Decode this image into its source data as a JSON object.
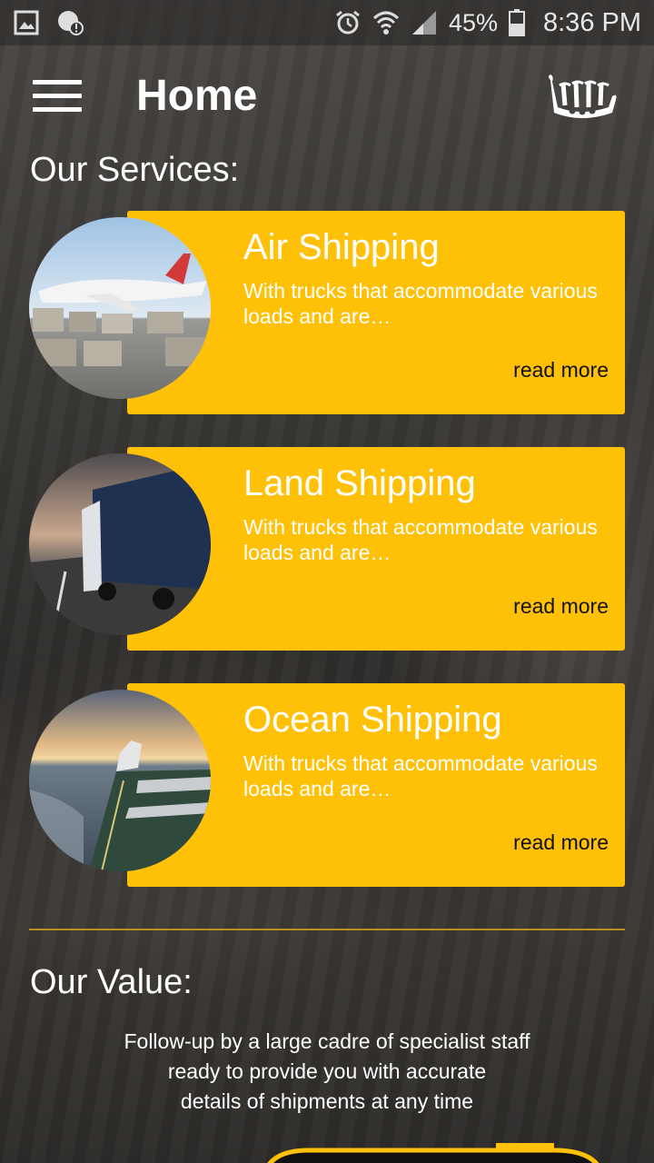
{
  "status_bar": {
    "battery": "45%",
    "time": "8:36 PM"
  },
  "app_bar": {
    "title": "Home",
    "menu_icon": "hamburger-menu-icon",
    "logo": "viking-ship-logo"
  },
  "services": {
    "heading": "Our Services:",
    "items": [
      {
        "title": "Air Shipping",
        "description": "With trucks that accommodate various loads and are…",
        "link": "read more",
        "image": "airplane-cargo-photo"
      },
      {
        "title": "Land Shipping",
        "description": "With trucks that accommodate various loads and are…",
        "link": "read more",
        "image": "truck-road-photo"
      },
      {
        "title": "Ocean Shipping",
        "description": "With trucks that accommodate various loads and are…",
        "link": "read more",
        "image": "cargo-ship-photo"
      }
    ]
  },
  "value": {
    "heading": "Our Value:",
    "line1": "Follow-up by a large cadre of specialist staff",
    "line2": "ready to provide you with accurate",
    "line3": "details of shipments at any time"
  },
  "colors": {
    "accent": "#ffc107",
    "divider": "#b8901e"
  }
}
